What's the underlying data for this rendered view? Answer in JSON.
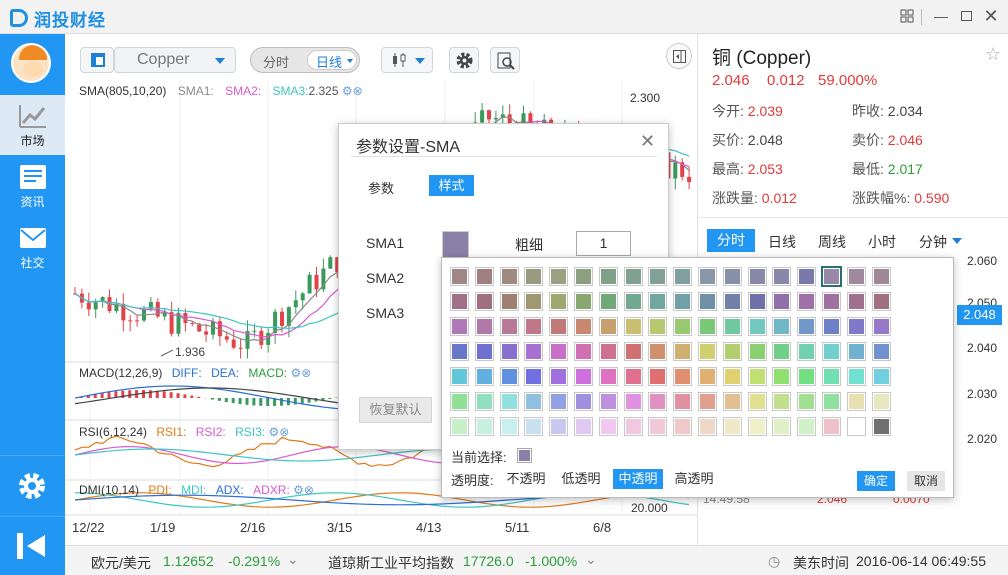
{
  "app": {
    "name": "润投财经"
  },
  "nav": {
    "items": [
      {
        "label": "市场"
      },
      {
        "label": "资讯"
      },
      {
        "label": "社交"
      }
    ]
  },
  "toolbar": {
    "symbol": "Copper",
    "timeshare": "分时",
    "daily": "日线"
  },
  "chart": {
    "sma_label": "SMA(805,10,20)",
    "sma1": "SMA1:",
    "sma2": "SMA2:",
    "sma3": "SMA3:",
    "sma3_val": "2.325",
    "high_label": "2.300",
    "low_label": "1.936",
    "macd_label": "MACD(12,26,9)",
    "diff": "DIFF:",
    "dea": "DEA:",
    "macd": "MACD:",
    "rsi_label": "RSI(6,12,24)",
    "rsi1": "RSI1:",
    "rsi2": "RSI2:",
    "rsi3": "RSI3:",
    "dmi_label": "DMI(10,14)",
    "pdi": "PDI:",
    "mdi": "MDI:",
    "adx": "ADX:",
    "adxr": "ADXR:",
    "dmi_axis": "20.000",
    "x_ticks": [
      "12/22",
      "1/19",
      "2/16",
      "3/15",
      "4/13",
      "5/11",
      "6/8"
    ]
  },
  "chart_data": {
    "type": "candlestick",
    "x_ticks": [
      "12/22",
      "1/19",
      "2/16",
      "3/15",
      "4/13",
      "5/11",
      "6/8"
    ],
    "annotations": [
      "2.300",
      "1.936"
    ],
    "colors": {
      "up": "#3a9a5c",
      "down": "#e0444a",
      "sma1": "#8a8a8a",
      "sma2": "#d65ad0",
      "sma3": "#3fc4c4"
    }
  },
  "quote": {
    "title": "铜 (Copper)",
    "price": "2.046",
    "change": "0.012",
    "change_pct": "59.000%",
    "open_label": "今开:",
    "open": "2.039",
    "prev_label": "昨收:",
    "prev": "2.034",
    "bid_label": "买价:",
    "bid": "2.048",
    "ask_label": "卖价:",
    "ask": "2.046",
    "high_label": "最高:",
    "high": "2.053",
    "low_label": "最低:",
    "low": "2.017",
    "chg_label": "涨跌量:",
    "chg": "0.012",
    "chgpct_label": "涨跌幅%:",
    "chgpct": "0.590",
    "tabs": [
      "分时",
      "日线",
      "周线",
      "小时",
      "分钟"
    ],
    "axis": [
      "2.060",
      "2.050",
      "2.040",
      "2.030",
      "2.020"
    ],
    "axis_highlight": "2.048",
    "trade_time": "14:49:58",
    "trade_price": "2.046",
    "trade_vol": "0.0070"
  },
  "dialog": {
    "title": "参数设置-SMA",
    "tab_params": "参数",
    "tab_style": "样式",
    "rows": [
      "SMA1",
      "SMA2",
      "SMA3"
    ],
    "thickness_label": "粗细",
    "thickness": "1",
    "reset": "恢复默认"
  },
  "palette": {
    "current_label": "当前选择:",
    "opacity_label": "透明度:",
    "opacity_options": [
      "不透明",
      "低透明",
      "中透明",
      "高透明"
    ],
    "ok": "确定",
    "cancel": "取消",
    "rows": [
      [
        "#a08888",
        "#a08080",
        "#a08a80",
        "#9a9a80",
        "#9aa080",
        "#8aa080",
        "#80a088",
        "#80a090",
        "#80a098",
        "#80a0a0",
        "#8898a8",
        "#8890a8",
        "#8888a8",
        "#8a88a8",
        "#7a7aaa",
        "#9a88a8",
        "#a088a0",
        "#a08898"
      ],
      [
        "#a07088",
        "#a07080",
        "#a08070",
        "#a09870",
        "#a0a870",
        "#88a870",
        "#70a878",
        "#70a890",
        "#70a8a0",
        "#70a0a8",
        "#7090a8",
        "#7080a8",
        "#7070a8",
        "#9070a8",
        "#a070a8",
        "#a070a0",
        "#a07090",
        "#a07080"
      ],
      [
        "#b078b8",
        "#b078a8",
        "#b87898",
        "#c07888",
        "#c07878",
        "#c88870",
        "#c8a070",
        "#c8c070",
        "#b8c870",
        "#98c870",
        "#78c878",
        "#70c8a0",
        "#70c8c0",
        "#70b8c8",
        "#7098c8",
        "#7080c8",
        "#8078c8",
        "#9878c8"
      ],
      [
        "#6878c8",
        "#7070d0",
        "#8870d0",
        "#a870d0",
        "#c870c8",
        "#d070b0",
        "#d07090",
        "#d07070",
        "#d09070",
        "#d0b070",
        "#d0d070",
        "#b0d070",
        "#88d070",
        "#70d088",
        "#70d0b0",
        "#70d0d0",
        "#70b0d0",
        "#7090d0"
      ],
      [
        "#60c8d8",
        "#60b0e0",
        "#6090e0",
        "#7070e0",
        "#a070e0",
        "#d070e0",
        "#e070c0",
        "#e07090",
        "#e07070",
        "#e09070",
        "#e0b070",
        "#e0d070",
        "#c0e070",
        "#90e070",
        "#70e080",
        "#70e0b0",
        "#70e0d0",
        "#70d0e0"
      ],
      [
        "#90e098",
        "#90e0c0",
        "#90e0e0",
        "#90c0e0",
        "#90a0e0",
        "#a090e0",
        "#c090e0",
        "#e090e0",
        "#e090c0",
        "#e090a0",
        "#e0a090",
        "#e0c090",
        "#e0e090",
        "#c0e090",
        "#a0e090",
        "#90e0a0",
        "#e8e0b0",
        "#e8e8c0"
      ],
      [
        "#c8f0c8",
        "#c8f0e0",
        "#c8f0f0",
        "#c8e0f0",
        "#c8c8f0",
        "#e0c8f0",
        "#f0c8f0",
        "#f0c8e0",
        "#f0c8d8",
        "#f0c8c8",
        "#f0d8c8",
        "#f0e8c8",
        "#f0f0c8",
        "#e0f0c8",
        "#d0f0c8",
        "#f0c0c8",
        "#ffffff",
        "#707070"
      ]
    ]
  },
  "status": {
    "t1_name": "欧元/美元",
    "t1_price": "1.12652",
    "t1_chg": "-0.291%",
    "t2_name": "道琼斯工业平均指数",
    "t2_price": "17726.0",
    "t2_chg": "-1.000%",
    "clock_label": "美东时间",
    "clock": "2016-06-14 06:49:55"
  }
}
